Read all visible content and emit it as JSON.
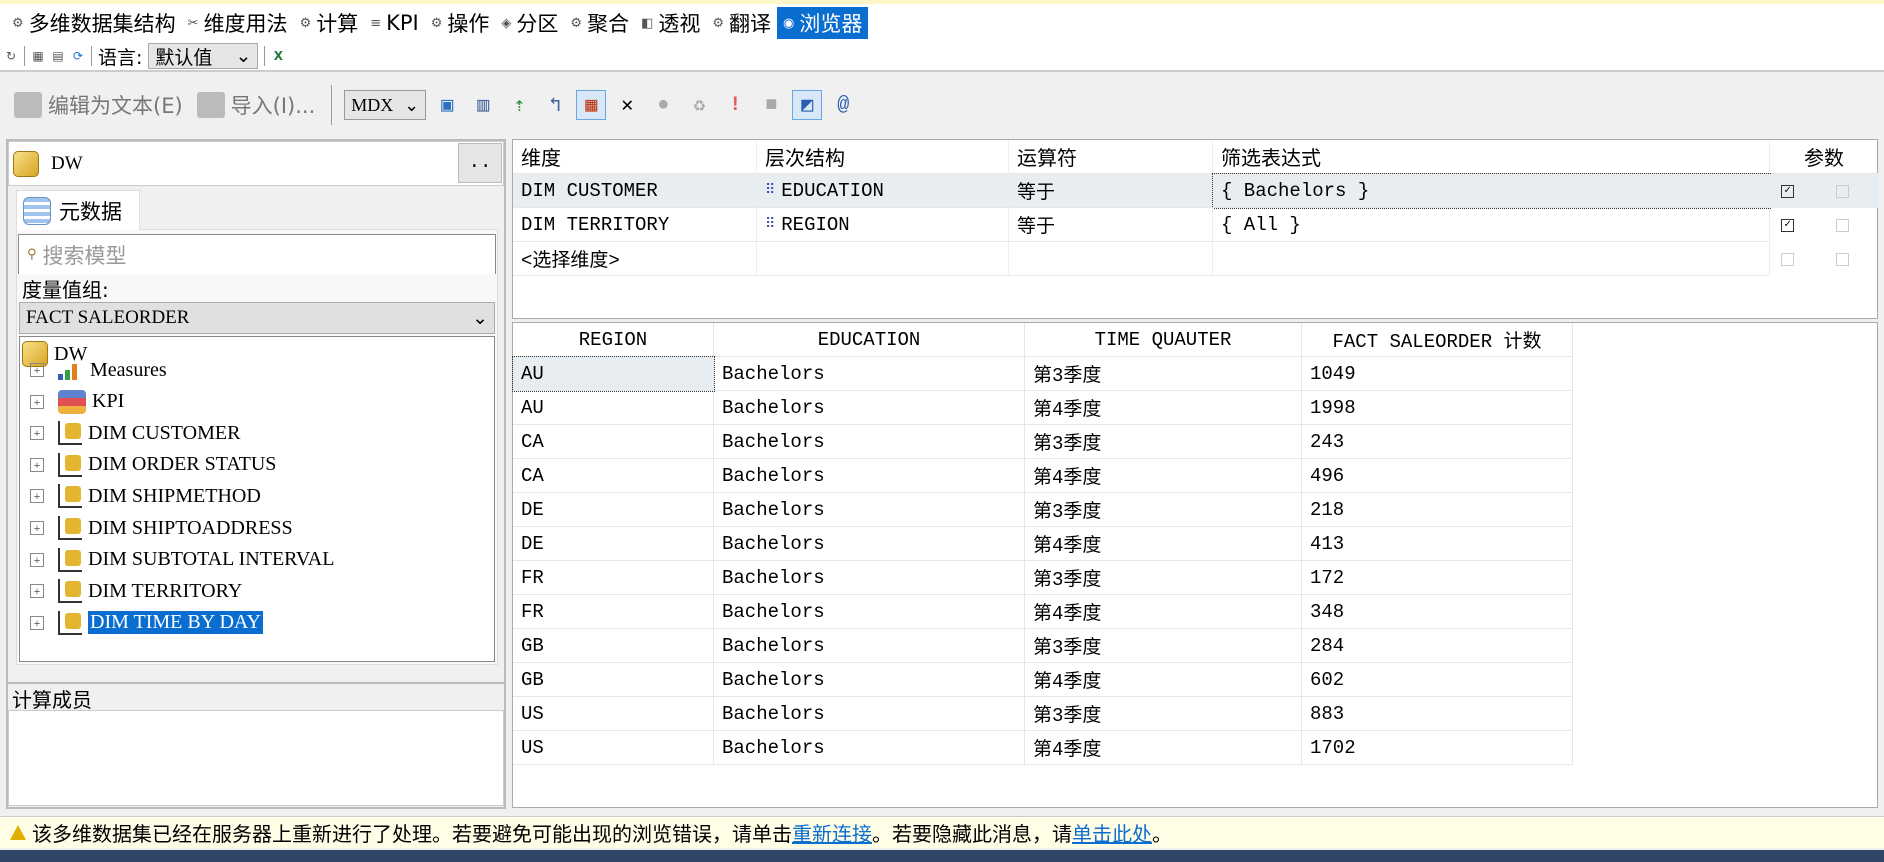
{
  "menu_tabs": [
    {
      "label": "多维数据集结构",
      "icon": "cube-structure-icon"
    },
    {
      "label": "维度用法",
      "icon": "dimension-usage-icon"
    },
    {
      "label": "计算",
      "icon": "calculations-icon"
    },
    {
      "label": "KPI",
      "icon": "kpi-icon"
    },
    {
      "label": "操作",
      "icon": "actions-icon"
    },
    {
      "label": "分区",
      "icon": "partitions-icon"
    },
    {
      "label": "聚合",
      "icon": "aggregations-icon"
    },
    {
      "label": "透视",
      "icon": "perspectives-icon"
    },
    {
      "label": "翻译",
      "icon": "translations-icon"
    },
    {
      "label": "浏览器",
      "icon": "browser-icon",
      "active": true
    }
  ],
  "row2": {
    "language_label": "语言:",
    "language_value": "默认值"
  },
  "toolbar": {
    "edit_as_text": "编辑为文本(E)",
    "import": "导入(I)...",
    "query_type": "MDX"
  },
  "left": {
    "cube_name": "DW",
    "dots": "..",
    "metadata_tab": "元数据",
    "search_placeholder": "搜索模型",
    "measure_group_label": "度量值组:",
    "measure_group_value": "FACT SALEORDER",
    "tree_root": "DW",
    "tree_items": [
      {
        "label": "Measures",
        "type": "measures"
      },
      {
        "label": "KPI",
        "type": "kpi"
      },
      {
        "label": "DIM CUSTOMER",
        "type": "dim"
      },
      {
        "label": "DIM ORDER STATUS",
        "type": "dim"
      },
      {
        "label": "DIM SHIPMETHOD",
        "type": "dim"
      },
      {
        "label": "DIM SHIPTOADDRESS",
        "type": "dim"
      },
      {
        "label": "DIM SUBTOTAL INTERVAL",
        "type": "dim"
      },
      {
        "label": "DIM TERRITORY",
        "type": "dim"
      },
      {
        "label": "DIM TIME BY DAY",
        "type": "dim",
        "selected": true
      }
    ],
    "calc_members_label": "计算成员"
  },
  "filter": {
    "headers": [
      "维度",
      "层次结构",
      "运算符",
      "筛选表达式",
      "参数"
    ],
    "rows": [
      {
        "dimension": "DIM CUSTOMER",
        "hierarchy": "EDUCATION",
        "operator": "等于",
        "expression": "{ Bachelors }",
        "checked": true,
        "param": false
      },
      {
        "dimension": "DIM TERRITORY",
        "hierarchy": "REGION",
        "operator": "等于",
        "expression": "{ All }",
        "checked": true,
        "param": false
      },
      {
        "dimension": "<选择维度>",
        "hierarchy": "",
        "operator": "",
        "expression": "",
        "checked": false,
        "param": false
      }
    ]
  },
  "results": {
    "headers": [
      "REGION",
      "EDUCATION",
      "TIME QUAUTER",
      "FACT SALEORDER 计数"
    ],
    "rows": [
      [
        "AU",
        "Bachelors",
        "第3季度",
        "1049"
      ],
      [
        "AU",
        "Bachelors",
        "第4季度",
        "1998"
      ],
      [
        "CA",
        "Bachelors",
        "第3季度",
        "243"
      ],
      [
        "CA",
        "Bachelors",
        "第4季度",
        "496"
      ],
      [
        "DE",
        "Bachelors",
        "第3季度",
        "218"
      ],
      [
        "DE",
        "Bachelors",
        "第4季度",
        "413"
      ],
      [
        "FR",
        "Bachelors",
        "第3季度",
        "172"
      ],
      [
        "FR",
        "Bachelors",
        "第4季度",
        "348"
      ],
      [
        "GB",
        "Bachelors",
        "第3季度",
        "284"
      ],
      [
        "GB",
        "Bachelors",
        "第4季度",
        "602"
      ],
      [
        "US",
        "Bachelors",
        "第3季度",
        "883"
      ],
      [
        "US",
        "Bachelors",
        "第4季度",
        "1702"
      ]
    ]
  },
  "status": {
    "text1": "该多维数据集已经在服务器上重新进行了处理。若要避免可能出现的浏览错误，请单击",
    "link1": "重新连接",
    "text2": "。若要隐藏此消息，请",
    "link2": "单击此处",
    "text3": "。"
  },
  "colors": {
    "accent": "#0a6ed1",
    "status_bg": "#fffde6",
    "selected_row": "#e8edf2"
  }
}
